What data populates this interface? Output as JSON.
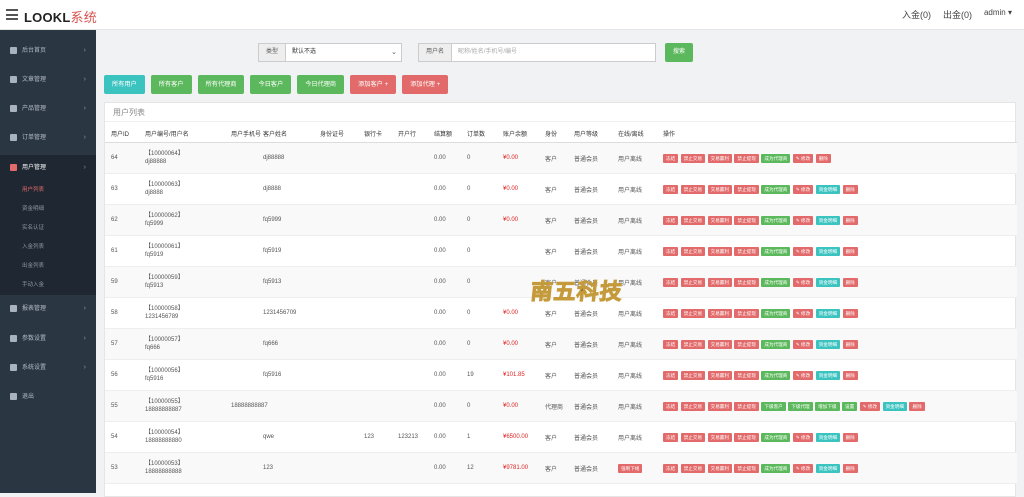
{
  "app": {
    "brand": "LOOKL",
    "brand_suffix": "系统"
  },
  "top": {
    "in": "入金(0)",
    "out": "出金(0)",
    "user": "admin ▾"
  },
  "sidebar": {
    "items": [
      {
        "label": "后台首页"
      },
      {
        "label": "文章管理"
      },
      {
        "label": "产品管理"
      },
      {
        "label": "订单管理"
      },
      {
        "label": "用户管理"
      },
      {
        "label": "报表管理"
      },
      {
        "label": "参数设置"
      },
      {
        "label": "系统设置"
      },
      {
        "label": "退出"
      }
    ],
    "sub": [
      "用户列表",
      "资金明细",
      "实名认证",
      "入金列表",
      "出金列表",
      "手动入金"
    ]
  },
  "filter": {
    "type_label": "类型",
    "type_value": "默认不选",
    "name_label": "用户名",
    "name_placeholder": "昵称/姓名/手机号/编号",
    "search": "搜索"
  },
  "tabs": [
    {
      "label": "所有用户",
      "color": "#3bc3c0"
    },
    {
      "label": "所有客户",
      "color": "#5cb85c"
    },
    {
      "label": "所有代理商",
      "color": "#5cb85c"
    },
    {
      "label": "今日客户",
      "color": "#5cb85c"
    },
    {
      "label": "今日代理商",
      "color": "#5cb85c"
    },
    {
      "label": "添加客户 +",
      "color": "#e26a6a"
    },
    {
      "label": "添加代理 +",
      "color": "#e26a6a"
    }
  ],
  "panel": {
    "title": "用户列表"
  },
  "headers": [
    "用户ID",
    "用户编号/用户名",
    "用户手机号",
    "客户姓名",
    "身份证号",
    "银行卡",
    "开户行",
    "结算额",
    "订单数",
    "账户余额",
    "身份",
    "用户等级",
    "在线/离线",
    "操作"
  ],
  "rows": [
    {
      "id": "64",
      "code": "【10000064】",
      "name": "dj88888",
      "phone": "",
      "cname": "dj88888",
      "idno": "",
      "card": "",
      "bank": "",
      "settle": "0.00",
      "orders": "0",
      "balance": "¥0.00",
      "role": "客户",
      "level": "普通会员",
      "online": "用户离线",
      "actions": [
        "冻结",
        "禁止交易",
        "交易赢利",
        "禁止提现",
        "成为代理商",
        "✎ 修改",
        "删除"
      ]
    },
    {
      "id": "63",
      "code": "【10000063】",
      "name": "dj8888",
      "phone": "",
      "cname": "dj8888",
      "idno": "",
      "card": "",
      "bank": "",
      "settle": "0.00",
      "orders": "0",
      "balance": "¥0.00",
      "role": "客户",
      "level": "普通会员",
      "online": "用户离线",
      "actions": [
        "冻结",
        "禁止交易",
        "交易赢利",
        "禁止提现",
        "成为代理商",
        "✎ 修改",
        "资金明细",
        "删除"
      ]
    },
    {
      "id": "62",
      "code": "【10000062】",
      "name": "fq5999",
      "phone": "",
      "cname": "fq5999",
      "idno": "",
      "card": "",
      "bank": "",
      "settle": "0.00",
      "orders": "0",
      "balance": "¥0.00",
      "role": "客户",
      "level": "普通会员",
      "online": "用户离线",
      "actions": [
        "冻结",
        "禁止交易",
        "交易赢利",
        "禁止提现",
        "成为代理商",
        "✎ 修改",
        "资金明细",
        "删除"
      ]
    },
    {
      "id": "61",
      "code": "【10000061】",
      "name": "fq5919",
      "phone": "",
      "cname": "fq5919",
      "idno": "",
      "card": "",
      "bank": "",
      "settle": "0.00",
      "orders": "0",
      "balance": "",
      "role": "客户",
      "level": "普通会员",
      "online": "用户离线",
      "actions": [
        "冻结",
        "禁止交易",
        "交易赢利",
        "禁止提现",
        "成为代理商",
        "✎ 修改",
        "资金明细",
        "删除"
      ]
    },
    {
      "id": "59",
      "code": "【10000059】",
      "name": "fq5913",
      "phone": "",
      "cname": "fq5913",
      "idno": "",
      "card": "",
      "bank": "",
      "settle": "0.00",
      "orders": "0",
      "balance": "",
      "role": "客户",
      "level": "普通会员",
      "online": "用户离线",
      "actions": [
        "冻结",
        "禁止交易",
        "交易赢利",
        "禁止提现",
        "成为代理商",
        "✎ 修改",
        "资金明细",
        "删除"
      ]
    },
    {
      "id": "58",
      "code": "【10000058】",
      "name": "1231456789",
      "phone": "",
      "cname": "1231456709",
      "idno": "",
      "card": "",
      "bank": "",
      "settle": "0.00",
      "orders": "0",
      "balance": "¥0.00",
      "role": "客户",
      "level": "普通会员",
      "online": "用户离线",
      "actions": [
        "冻结",
        "禁止交易",
        "交易赢利",
        "禁止提现",
        "成为代理商",
        "✎ 修改",
        "资金明细",
        "删除"
      ]
    },
    {
      "id": "57",
      "code": "【10000057】",
      "name": "fq666",
      "phone": "",
      "cname": "fq666",
      "idno": "",
      "card": "",
      "bank": "",
      "settle": "0.00",
      "orders": "0",
      "balance": "¥0.00",
      "role": "客户",
      "level": "普通会员",
      "online": "用户离线",
      "actions": [
        "冻结",
        "禁止交易",
        "交易赢利",
        "禁止提现",
        "成为代理商",
        "✎ 修改",
        "资金明细",
        "删除"
      ]
    },
    {
      "id": "56",
      "code": "【10000056】",
      "name": "fq5916",
      "phone": "",
      "cname": "fq5916",
      "idno": "",
      "card": "",
      "bank": "",
      "settle": "0.00",
      "orders": "19",
      "balance": "¥101.85",
      "role": "客户",
      "level": "普通会员",
      "online": "用户离线",
      "actions": [
        "冻结",
        "禁止交易",
        "交易赢利",
        "禁止提现",
        "成为代理商",
        "✎ 修改",
        "资金明细",
        "删除"
      ]
    },
    {
      "id": "55",
      "code": "【10000055】",
      "name": "18888888887",
      "phone": "18888888887",
      "cname": "",
      "idno": "",
      "card": "",
      "bank": "",
      "settle": "0.00",
      "orders": "0",
      "balance": "¥0.00",
      "role": "代理商",
      "level": "普通会员",
      "online": "用户离线",
      "actions": [
        "冻结",
        "禁止交易",
        "交易赢利",
        "禁止提现",
        "下级客户",
        "下级代理",
        "增加下级",
        "设置",
        "✎ 修改",
        "资金明细",
        "删除"
      ]
    },
    {
      "id": "54",
      "code": "【10000054】",
      "name": "18888888880",
      "phone": "",
      "cname": "qwe",
      "idno": "",
      "card": "123",
      "bank": "123213",
      "settle": "0.00",
      "orders": "1",
      "balance": "¥6500.00",
      "role": "客户",
      "level": "普通会员",
      "online": "用户离线",
      "actions": [
        "冻结",
        "禁止交易",
        "交易赢利",
        "禁止提现",
        "成为代理商",
        "✎ 修改",
        "资金明细",
        "删除"
      ]
    },
    {
      "id": "53",
      "code": "【10000053】",
      "name": "18888888888",
      "phone": "",
      "cname": "123",
      "idno": "",
      "card": "",
      "bank": "",
      "settle": "0.00",
      "orders": "12",
      "balance": "¥9781.00",
      "role": "客户",
      "level": "普通会员",
      "online": "强制下线",
      "actions": [
        "冻结",
        "禁止交易",
        "交易赢利",
        "禁止提现",
        "成为代理商",
        "✎ 修改",
        "资金明细",
        "删除"
      ]
    }
  ],
  "watermark": "南五科技"
}
